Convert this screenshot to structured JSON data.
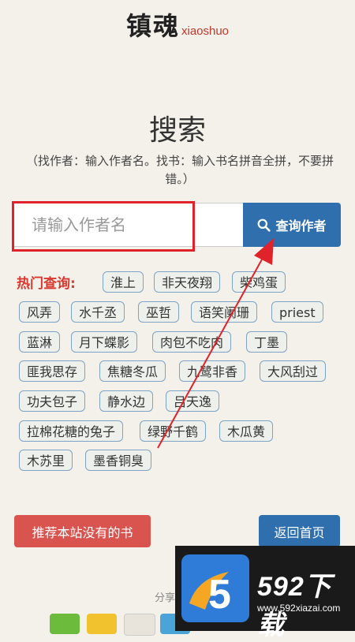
{
  "header": {
    "logo_cn": "镇魂",
    "logo_en": "xiaoshuo"
  },
  "page": {
    "title": "搜索",
    "hint": "（找作者：输入作者名。找书：输入书名拼音全拼，不要拼错。）"
  },
  "search": {
    "placeholder": "请输入作者名",
    "value": "",
    "button_label": "查询作者"
  },
  "hot": {
    "label": "热门查询:",
    "tags": [
      "淮上",
      "非天夜翔",
      "柴鸡蛋",
      "风弄",
      "水千丞",
      "巫哲",
      "语笑阑珊",
      "priest",
      "蓝淋",
      "月下蝶影",
      "肉包不吃肉",
      "丁墨",
      "匪我思存",
      "焦糖冬瓜",
      "九鹭非香",
      "大风刮过",
      "功夫包子",
      "静水边",
      "吕天逸",
      "拉棉花糖的兔子",
      "绿野千鹤",
      "木瓜黄",
      "木苏里",
      "墨香铜臭"
    ]
  },
  "actions": {
    "recommend_label": "推荐本站没有的书",
    "home_label": "返回首页"
  },
  "share": {
    "label": "分享"
  },
  "watermark": {
    "badge_digit": "5",
    "brand": "592下载",
    "url": "www.592xiazai.com"
  },
  "colors": {
    "accent_blue": "#2f6fad",
    "accent_red": "#d9534f",
    "highlight_red": "#e0232a",
    "background": "#f4f1ea"
  }
}
